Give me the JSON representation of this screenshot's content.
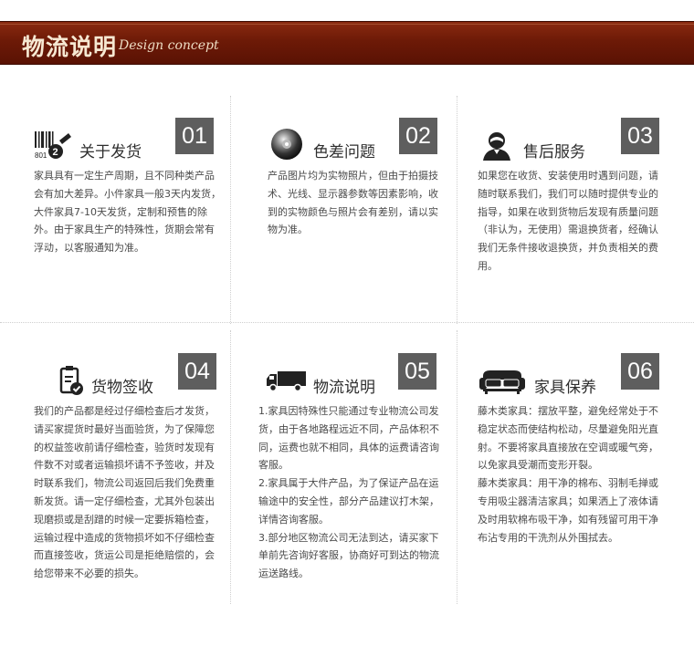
{
  "banner": {
    "title": "物流说明",
    "subtitle": "Design concept"
  },
  "cards": [
    {
      "number": "01",
      "title": "关于发货",
      "icon": "barcode-shipping-icon",
      "paragraphs": [
        "家具具有一定生产周期，且不同种类产品会有加大差异。小件家具一般3天内发货，大件家具7-10天发货，定制和预售的除外。由于家具生产的特殊性，货期会常有浮动，以客服通知为准。"
      ]
    },
    {
      "number": "02",
      "title": "色差问题",
      "icon": "color-disc-icon",
      "paragraphs": [
        "产品图片均为实物照片，但由于拍摄技术、光线、显示器参数等因素影响，收到的实物颜色与照片会有差别，请以实物为准。"
      ]
    },
    {
      "number": "03",
      "title": "售后服务",
      "icon": "customer-service-icon",
      "paragraphs": [
        "如果您在收货、安装使用时遇到问题，请随时联系我们，我们可以随时提供专业的指导，如果在收到货物后发现有质量问题（非认为，无使用）需退换货者，经确认我们无条件接收退换货，并负责相关的费用。"
      ]
    },
    {
      "number": "04",
      "title": "货物签收",
      "icon": "clipboard-check-icon",
      "paragraphs": [
        "我们的产品都是经过仔细检查后才发货，请买家提货时最好当面验货，为了保障您的权益签收前请仔细检查，验货时发现有件数不对或者运输损坏请不予签收，并及时联系我们，物流公司返回后我们免费重新发货。请一定仔细检查，尤其外包装出现磨损或是刮蹭的时候一定要拆箱检查，运输过程中造成的货物损坏如不仔细检查而直接签收，货运公司是拒绝赔偿的，会给您带来不必要的损失。"
      ]
    },
    {
      "number": "05",
      "title": "物流说明",
      "icon": "truck-icon",
      "paragraphs": [
        "1.家具因特殊性只能通过专业物流公司发货，由于各地路程远近不同，产品体积不同，运费也就不相同，具体的运费请咨询客服。",
        "2.家具属于大件产品，为了保证产品在运输途中的安全性，部分产品建议打木架，详情咨询客服。",
        "3.部分地区物流公司无法到达，请买家下单前先咨询好客服，协商好可到达的物流运送路线。"
      ]
    },
    {
      "number": "06",
      "title": "家具保养",
      "icon": "sofa-icon",
      "paragraphs": [
        "藤木类家具：摆放平整，避免经常处于不稳定状态而使结构松动，尽量避免阳光直射。不要将家具直接放在空调或暖气旁，以免家具受潮而变形开裂。",
        "藤木类家具：用干净的棉布、羽制毛掸或专用吸尘器清洁家具；如果洒上了液体请及时用软棉布吸干净，如有残留可用干净布沾专用的干洗剂从外围拭去。"
      ]
    }
  ]
}
